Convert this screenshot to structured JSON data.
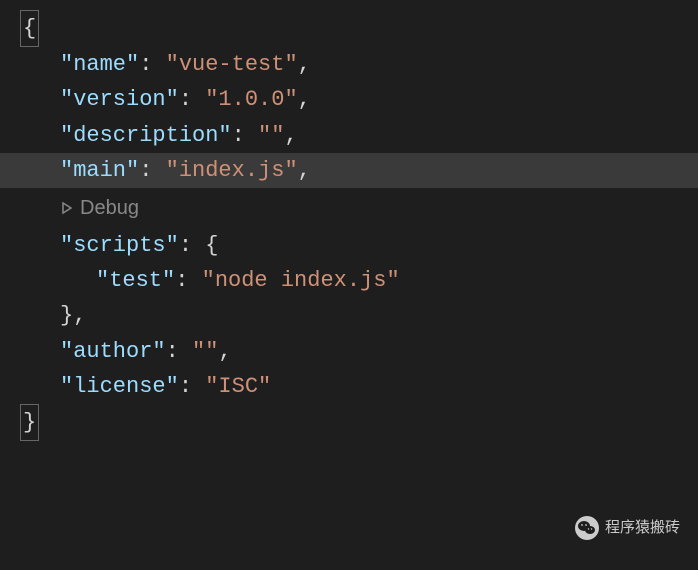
{
  "json_data": {
    "name_key": "\"name\"",
    "name_val": "\"vue-test\"",
    "version_key": "\"version\"",
    "version_val": "\"1.0.0\"",
    "description_key": "\"description\"",
    "description_val": "\"\"",
    "main_key": "\"main\"",
    "main_val": "\"index.js\"",
    "scripts_key": "\"scripts\"",
    "test_key": "\"test\"",
    "test_val": "\"node index.js\"",
    "author_key": "\"author\"",
    "author_val": "\"\"",
    "license_key": "\"license\"",
    "license_val": "\"ISC\""
  },
  "codelens": {
    "debug_label": "Debug"
  },
  "watermark": {
    "text": "程序猿搬砖"
  }
}
